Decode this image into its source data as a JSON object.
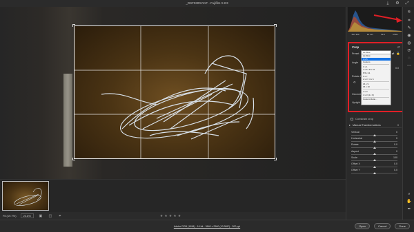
{
  "app": {
    "title": "_DSF0300.RAF - Fujifilm X-E3"
  },
  "titlebar": {
    "icons": [
      "download-icon",
      "gear-icon",
      "expand-icon"
    ]
  },
  "histogram": {
    "info": [
      "ISO 320",
      "10 mm",
      "f/2.0",
      "1/30s"
    ]
  },
  "crop_panel": {
    "title": "Crop",
    "preset_label": "Preset",
    "angle_label": "Angle",
    "rotate_label": "Rotate & flip",
    "geometry_label": "Geometry",
    "upright_label": "Upright",
    "dropdown": {
      "current": "As Shot",
      "options": [
        "As Shot",
        "4 x 5",
        "Custom",
        "1 x 1",
        "4 x 5 / 8 x 10",
        "8.5 x 11",
        "5 x 7",
        "2 x 3 / 4 x 6",
        "16 x 9",
        "16 x 10",
        "4 x 3",
        "4 x 3 (4 x 6)",
        "Custom Ratio..."
      ],
      "selected_index": 1
    },
    "angle_value": "0.0"
  },
  "constrain": {
    "label": "Constrain crop"
  },
  "manual_transform": {
    "title": "Manual Transformations",
    "rows": [
      {
        "label": "Vertical",
        "value": "0",
        "pos": 0.5
      },
      {
        "label": "Horizontal",
        "value": "0",
        "pos": 0.5
      },
      {
        "label": "Rotate",
        "value": "0.0",
        "pos": 0.5
      },
      {
        "label": "Aspect",
        "value": "0",
        "pos": 0.5
      },
      {
        "label": "Scale",
        "value": "100",
        "pos": 0.5
      },
      {
        "label": "Offset X",
        "value": "0.0",
        "pos": 0.5
      },
      {
        "label": "Offset Y",
        "value": "0.0",
        "pos": 0.5
      }
    ]
  },
  "bottombar": {
    "fit": "Fit (19.7%)",
    "zoom": "23.8%"
  },
  "rating": {
    "stars": [
      "★",
      "★",
      "★",
      "★",
      "★"
    ]
  },
  "footer": {
    "info": "Adobe RGB (1998) - 16 bit - 3840 x 2560 (10.3MP) - 300 ppi",
    "open_label": "Open",
    "cancel_label": "Cancel",
    "done_label": "Done"
  },
  "colors": {
    "accent_red": "#e01f26",
    "selection_blue": "#1473e6"
  }
}
